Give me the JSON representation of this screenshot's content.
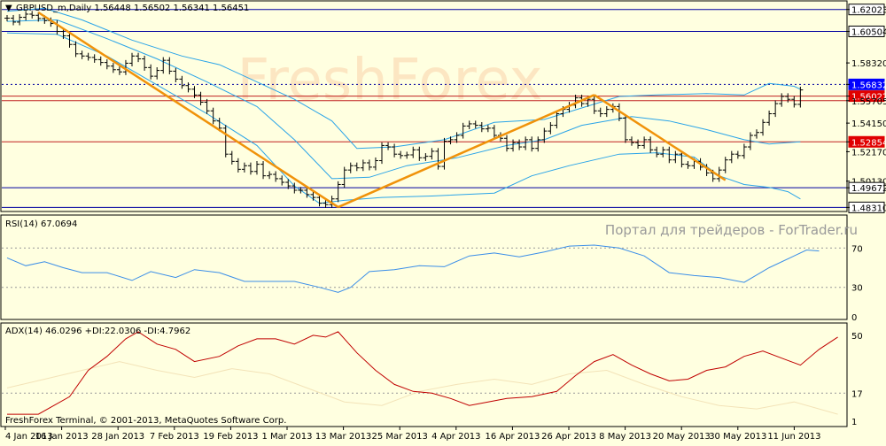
{
  "colors": {
    "background": "#ffffe0",
    "frame": "#000000",
    "bar": "#000000",
    "bollinger": "#2aa4e8",
    "trendline": "#f0920a",
    "support_line": "#0000a0",
    "resistance_line": "#c02020",
    "price_tag_red": "#e00000",
    "price_tag_blue": "#0000ff",
    "rsi_line": "#3b8ee8",
    "adx_line": "#c00000",
    "watermark": "#f7b98c"
  },
  "watermark": "FreshForex",
  "site_caption": "Портал для трейдеров - ForTrader.ru",
  "footer": "FreshForex Terminal, © 2001-2013, MetaQuotes Software Corp.",
  "chart_data": [
    {
      "type": "candlestick",
      "title": "GBPUSD_m,Daily  1.56448 1.56502 1.56341 1.56451",
      "ylim": [
        1.4815,
        1.6225
      ],
      "y_ticks": [
        {
          "value": "1.62023",
          "style": "plain"
        },
        {
          "value": "1.60504",
          "style": "plain"
        },
        {
          "value": "1.58320",
          "style": "plain"
        },
        {
          "value": "1.56832",
          "style": "blue"
        },
        {
          "value": "1.56022",
          "style": "red"
        },
        {
          "value": "1.55705",
          "style": "plain"
        },
        {
          "value": "1.54150",
          "style": "plain"
        },
        {
          "value": "1.52854",
          "style": "red"
        },
        {
          "value": "1.52170",
          "style": "plain"
        },
        {
          "value": "1.50130",
          "style": "plain"
        },
        {
          "value": "1.49672",
          "style": "plain"
        },
        {
          "value": "1.48310",
          "style": "plain"
        }
      ],
      "horizontal_levels": [
        {
          "value": 1.62023,
          "kind": "support"
        },
        {
          "value": 1.60504,
          "kind": "support"
        },
        {
          "value": 1.56832,
          "kind": "dotted"
        },
        {
          "value": 1.56022,
          "kind": "resistance"
        },
        {
          "value": 1.55705,
          "kind": "resistance"
        },
        {
          "value": 1.52854,
          "kind": "resistance"
        },
        {
          "value": 1.49672,
          "kind": "support"
        },
        {
          "value": 1.4831,
          "kind": "support"
        }
      ],
      "x_labels": [
        "4 Jan 2013",
        "16 Jan 2013",
        "28 Jan 2013",
        "7 Feb 2013",
        "19 Feb 2013",
        "1 Mar 2013",
        "13 Mar 2013",
        "25 Mar 2013",
        "4 Apr 2013",
        "16 Apr 2013",
        "26 Apr 2013",
        "8 May 2013",
        "20 May 2013",
        "30 May 2013",
        "11 Jun 2013"
      ],
      "closes": [
        1.6142,
        1.6115,
        1.6148,
        1.617,
        1.6162,
        1.614,
        1.6125,
        1.6105,
        1.605,
        1.602,
        1.596,
        1.5895,
        1.588,
        1.587,
        1.5855,
        1.5835,
        1.581,
        1.5785,
        1.577,
        1.583,
        1.588,
        1.586,
        1.58,
        1.574,
        1.578,
        1.585,
        1.5775,
        1.572,
        1.5675,
        1.565,
        1.561,
        1.556,
        1.55,
        1.543,
        1.538,
        1.52,
        1.515,
        1.5095,
        1.512,
        1.508,
        1.513,
        1.505,
        1.506,
        1.503,
        1.5005,
        1.498,
        1.495,
        1.495,
        1.492,
        1.49,
        1.486,
        1.485,
        1.489,
        1.499,
        1.509,
        1.512,
        1.5105,
        1.514,
        1.511,
        1.5155,
        1.526,
        1.525,
        1.52,
        1.519,
        1.5195,
        1.523,
        1.5175,
        1.5185,
        1.522,
        1.5115,
        1.529,
        1.53,
        1.533,
        1.5395,
        1.541,
        1.54,
        1.5375,
        1.538,
        1.533,
        1.531,
        1.524,
        1.528,
        1.525,
        1.53,
        1.524,
        1.53,
        1.536,
        1.54,
        1.548,
        1.551,
        1.554,
        1.559,
        1.555,
        1.558,
        1.55,
        1.548,
        1.551,
        1.553,
        1.545,
        1.53,
        1.528,
        1.526,
        1.53,
        1.523,
        1.52,
        1.523,
        1.516,
        1.52,
        1.513,
        1.512,
        1.515,
        1.511,
        1.507,
        1.503,
        1.509,
        1.516,
        1.52,
        1.519,
        1.525,
        1.533,
        1.535,
        1.542,
        1.548,
        1.555,
        1.56,
        1.558,
        1.5545,
        1.5645
      ],
      "bollinger": {
        "upper": [
          [
            0,
            1.619
          ],
          [
            6,
            1.621
          ],
          [
            12,
            1.613
          ],
          [
            20,
            1.599
          ],
          [
            28,
            1.588
          ],
          [
            34,
            1.582
          ],
          [
            40,
            1.57
          ],
          [
            46,
            1.558
          ],
          [
            52,
            1.543
          ],
          [
            56,
            1.524
          ],
          [
            62,
            1.525
          ],
          [
            70,
            1.53
          ],
          [
            78,
            1.542
          ],
          [
            86,
            1.544
          ],
          [
            92,
            1.552
          ],
          [
            98,
            1.56
          ],
          [
            104,
            1.561
          ],
          [
            112,
            1.562
          ],
          [
            118,
            1.561
          ],
          [
            122,
            1.569
          ],
          [
            126,
            1.567
          ],
          [
            127,
            1.565
          ]
        ],
        "middle": [
          [
            0,
            1.612
          ],
          [
            8,
            1.613
          ],
          [
            16,
            1.6
          ],
          [
            24,
            1.586
          ],
          [
            32,
            1.57
          ],
          [
            40,
            1.553
          ],
          [
            46,
            1.53
          ],
          [
            52,
            1.503
          ],
          [
            58,
            1.504
          ],
          [
            64,
            1.512
          ],
          [
            72,
            1.5175
          ],
          [
            80,
            1.526
          ],
          [
            86,
            1.53
          ],
          [
            92,
            1.54
          ],
          [
            100,
            1.546
          ],
          [
            106,
            1.543
          ],
          [
            112,
            1.537
          ],
          [
            118,
            1.53
          ],
          [
            122,
            1.527
          ],
          [
            125,
            1.528
          ],
          [
            127,
            1.5285
          ]
        ],
        "lower": [
          [
            0,
            1.604
          ],
          [
            8,
            1.603
          ],
          [
            16,
            1.588
          ],
          [
            24,
            1.568
          ],
          [
            32,
            1.548
          ],
          [
            40,
            1.526
          ],
          [
            46,
            1.498
          ],
          [
            50,
            1.486
          ],
          [
            54,
            1.488
          ],
          [
            60,
            1.49
          ],
          [
            68,
            1.491
          ],
          [
            78,
            1.493
          ],
          [
            84,
            1.505
          ],
          [
            90,
            1.512
          ],
          [
            98,
            1.52
          ],
          [
            104,
            1.521
          ],
          [
            110,
            1.518
          ],
          [
            114,
            1.505
          ],
          [
            118,
            1.499
          ],
          [
            122,
            1.497
          ],
          [
            125,
            1.494
          ],
          [
            127,
            1.489
          ]
        ]
      },
      "trendlines": [
        {
          "from": [
            5,
            1.6182
          ],
          "to": [
            53,
            1.4833
          ]
        },
        {
          "from": [
            53,
            1.4833
          ],
          "to": [
            94,
            1.561
          ]
        },
        {
          "from": [
            94,
            1.561
          ],
          "to": [
            115,
            1.502
          ]
        }
      ]
    },
    {
      "type": "line",
      "title": "RSI(14) 67.0694",
      "ylim": [
        0,
        100
      ],
      "y_ticks": [
        "70",
        "30",
        "0"
      ],
      "levels": [
        70,
        30
      ],
      "values": [
        [
          0,
          60
        ],
        [
          3,
          52
        ],
        [
          6,
          56
        ],
        [
          9,
          50
        ],
        [
          12,
          45
        ],
        [
          16,
          45
        ],
        [
          20,
          37
        ],
        [
          23,
          46
        ],
        [
          27,
          40
        ],
        [
          30,
          48
        ],
        [
          34,
          45
        ],
        [
          38,
          36
        ],
        [
          42,
          36
        ],
        [
          46,
          36
        ],
        [
          50,
          30
        ],
        [
          53,
          25
        ],
        [
          55,
          30
        ],
        [
          58,
          46
        ],
        [
          62,
          48
        ],
        [
          66,
          52
        ],
        [
          70,
          51
        ],
        [
          74,
          62
        ],
        [
          78,
          65
        ],
        [
          82,
          61
        ],
        [
          86,
          66
        ],
        [
          90,
          72
        ],
        [
          94,
          73
        ],
        [
          98,
          70
        ],
        [
          102,
          62
        ],
        [
          106,
          45
        ],
        [
          110,
          42
        ],
        [
          114,
          40
        ],
        [
          118,
          35
        ],
        [
          122,
          50
        ],
        [
          126,
          62
        ],
        [
          128,
          68
        ],
        [
          130,
          67
        ]
      ]
    },
    {
      "type": "line",
      "title": "ADX(14) 46.0296 +DI:22.0306 -DI:4.7962",
      "ylim": [
        0,
        55
      ],
      "y_ticks": [
        "50",
        "17",
        "1"
      ],
      "levels": [
        17
      ],
      "series": [
        {
          "values": [
            [
              0,
              5
            ],
            [
              5,
              5
            ],
            [
              10,
              15
            ],
            [
              13,
              30
            ],
            [
              16,
              38
            ],
            [
              19,
              48
            ],
            [
              21,
              52
            ],
            [
              24,
              45
            ],
            [
              27,
              42
            ],
            [
              30,
              35
            ],
            [
              34,
              38
            ],
            [
              37,
              44
            ],
            [
              40,
              48
            ],
            [
              43,
              48
            ],
            [
              46,
              45
            ],
            [
              49,
              50
            ],
            [
              51,
              49
            ],
            [
              53,
              52
            ],
            [
              56,
              40
            ],
            [
              59,
              30
            ],
            [
              62,
              22
            ],
            [
              65,
              18
            ],
            [
              68,
              17
            ],
            [
              71,
              14
            ],
            [
              74,
              10
            ],
            [
              77,
              12
            ],
            [
              80,
              14
            ],
            [
              84,
              15
            ],
            [
              88,
              18
            ],
            [
              91,
              27
            ],
            [
              94,
              35
            ],
            [
              97,
              39
            ],
            [
              100,
              33
            ],
            [
              103,
              28
            ],
            [
              106,
              24
            ],
            [
              109,
              25
            ],
            [
              112,
              30
            ],
            [
              115,
              32
            ],
            [
              118,
              38
            ],
            [
              121,
              41
            ],
            [
              124,
              37
            ],
            [
              127,
              33
            ],
            [
              130,
              42
            ],
            [
              133,
              49
            ]
          ]
        },
        {
          "values": [
            [
              0,
              20
            ],
            [
              6,
              25
            ],
            [
              12,
              30
            ],
            [
              18,
              35
            ],
            [
              24,
              30
            ],
            [
              30,
              26
            ],
            [
              36,
              31
            ],
            [
              42,
              28
            ],
            [
              48,
              20
            ],
            [
              54,
              12
            ],
            [
              60,
              10
            ],
            [
              66,
              18
            ],
            [
              72,
              22
            ],
            [
              78,
              25
            ],
            [
              84,
              22
            ],
            [
              90,
              28
            ],
            [
              96,
              30
            ],
            [
              102,
              22
            ],
            [
              108,
              15
            ],
            [
              114,
              10
            ],
            [
              120,
              8
            ],
            [
              126,
              12
            ],
            [
              133,
              5
            ]
          ]
        }
      ]
    }
  ]
}
